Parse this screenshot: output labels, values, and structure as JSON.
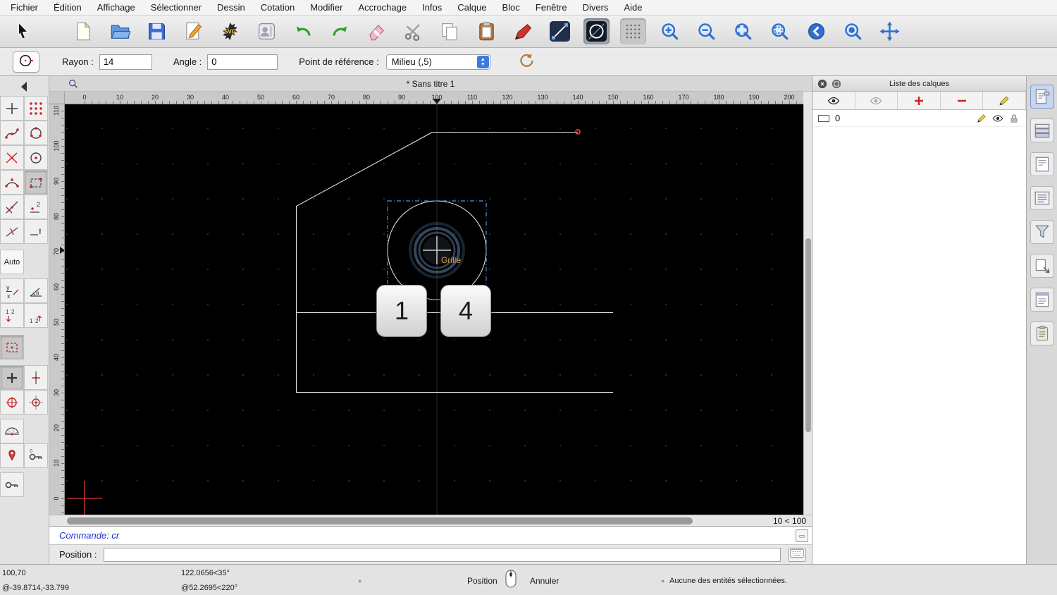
{
  "colors": {
    "canvas_bg": "#000000",
    "selection_blue": "#5b8dd9",
    "accent_red": "#c03030",
    "grille_orange": "#dda249",
    "zoom_blue": "#2f6fd0"
  },
  "menu_bar": {
    "items": [
      "Fichier",
      "Édition",
      "Affichage",
      "Sélectionner",
      "Dessin",
      "Cotation",
      "Modifier",
      "Accrochage",
      "Infos",
      "Calque",
      "Bloc",
      "Fenêtre",
      "Divers",
      "Aide"
    ]
  },
  "toolbar": {
    "icons": [
      {
        "name": "cursor"
      },
      {
        "name": "new-file"
      },
      {
        "name": "open-folder"
      },
      {
        "name": "save"
      },
      {
        "name": "edit-doc"
      },
      {
        "name": "svg-export"
      },
      {
        "name": "contacts"
      },
      {
        "name": "undo"
      },
      {
        "name": "redo"
      },
      {
        "name": "eraser"
      },
      {
        "name": "scissors"
      },
      {
        "name": "copy"
      },
      {
        "name": "paste"
      },
      {
        "name": "red-pen"
      },
      {
        "name": "line-style"
      },
      {
        "name": "circle-tool",
        "selected": true
      },
      {
        "name": "grid-toggle",
        "pressed": true
      },
      {
        "name": "zoom-in"
      },
      {
        "name": "zoom-out"
      },
      {
        "name": "zoom-fit"
      },
      {
        "name": "zoom-window"
      },
      {
        "name": "zoom-back"
      },
      {
        "name": "zoom-selected"
      },
      {
        "name": "pan"
      }
    ]
  },
  "options_bar": {
    "radius_label": "Rayon :",
    "radius_value": "14",
    "angle_label": "Angle :",
    "angle_value": "0",
    "reference_label": "Point de référence :",
    "reference_value": "Milieu (,5)"
  },
  "tool_palette": {
    "auto_label": "Auto",
    "rows": [
      {
        "full": true,
        "cells": [
          {
            "icon": "collapse-arrow"
          }
        ]
      },
      {
        "cells": [
          {
            "icon": "point-cross"
          },
          {
            "icon": "point-grid"
          }
        ]
      },
      {
        "cells": [
          {
            "icon": "spline-points"
          },
          {
            "icon": "circle-3pt"
          }
        ]
      },
      {
        "cells": [
          {
            "icon": "cross-red"
          },
          {
            "icon": "circle-center"
          }
        ]
      },
      {
        "cells": [
          {
            "icon": "arc-3pt"
          },
          {
            "icon": "rect-2pt",
            "pressed": true
          }
        ]
      },
      {
        "cells": [
          {
            "icon": "lines-angle"
          },
          {
            "icon": "point-2"
          }
        ]
      },
      {
        "cells": [
          {
            "icon": "line-slash"
          },
          {
            "icon": "line-exclaim"
          }
        ]
      },
      {
        "cells": [
          {
            "icon": "auto-text"
          }
        ]
      },
      {
        "cells": [
          {
            "icon": "coord-yx"
          },
          {
            "icon": "angle-a"
          }
        ]
      },
      {
        "cells": [
          {
            "icon": "ord-down"
          },
          {
            "icon": "ord-up"
          }
        ]
      },
      {
        "cells": [
          {
            "icon": "red-dash-rect",
            "pressed": true
          }
        ]
      },
      {
        "cells": [
          {
            "icon": "plus-bold",
            "pressed": true
          },
          {
            "icon": "snap-vertical"
          }
        ]
      },
      {
        "cells": [
          {
            "icon": "snap-circle-cross"
          },
          {
            "icon": "snap-circle-plus"
          }
        ]
      },
      {
        "cells": [
          {
            "icon": "protractor"
          }
        ]
      },
      {
        "cells": [
          {
            "icon": "snap-pin"
          },
          {
            "icon": "key-0"
          }
        ]
      },
      {
        "cells": [
          {
            "icon": "key-plain"
          }
        ]
      }
    ]
  },
  "document": {
    "title": "* Sans titre 1",
    "h_ruler": [
      0,
      10,
      20,
      30,
      40,
      50,
      60,
      70,
      80,
      90,
      100,
      110,
      120,
      130,
      140,
      150,
      160,
      170,
      180,
      190,
      200
    ],
    "v_ruler": [
      110,
      100,
      90,
      80,
      70,
      60,
      50,
      40,
      30,
      20,
      10,
      0
    ],
    "grille_label": "Grille",
    "keys": [
      "1",
      "4"
    ],
    "zoom_status": "10 < 100"
  },
  "layers_panel": {
    "title": "Liste des calques",
    "toolbar_icons": [
      "show-all-eye",
      "hide-all-eye",
      "add-layer",
      "delete-layer",
      "edit-layer"
    ],
    "layers": [
      {
        "name": "0"
      }
    ]
  },
  "right_strip": {
    "icons": [
      "panel-properties",
      "panel-structure",
      "panel-sheet",
      "panel-list",
      "panel-filter",
      "panel-reference",
      "panel-report",
      "panel-clipboard"
    ]
  },
  "command_line": {
    "text": "Commande: cr"
  },
  "position_bar": {
    "label": "Position :",
    "value": ""
  },
  "status_bar": {
    "coord_abs": "100,70",
    "coord_rel": "@-39.8714,-33.799",
    "polar_abs": "122.0656<35°",
    "polar_rel": "@52.2695<220°",
    "position_label": "Position",
    "cancel_label": "Annuler",
    "selection_info": "Aucune des entités sélectionnées."
  }
}
